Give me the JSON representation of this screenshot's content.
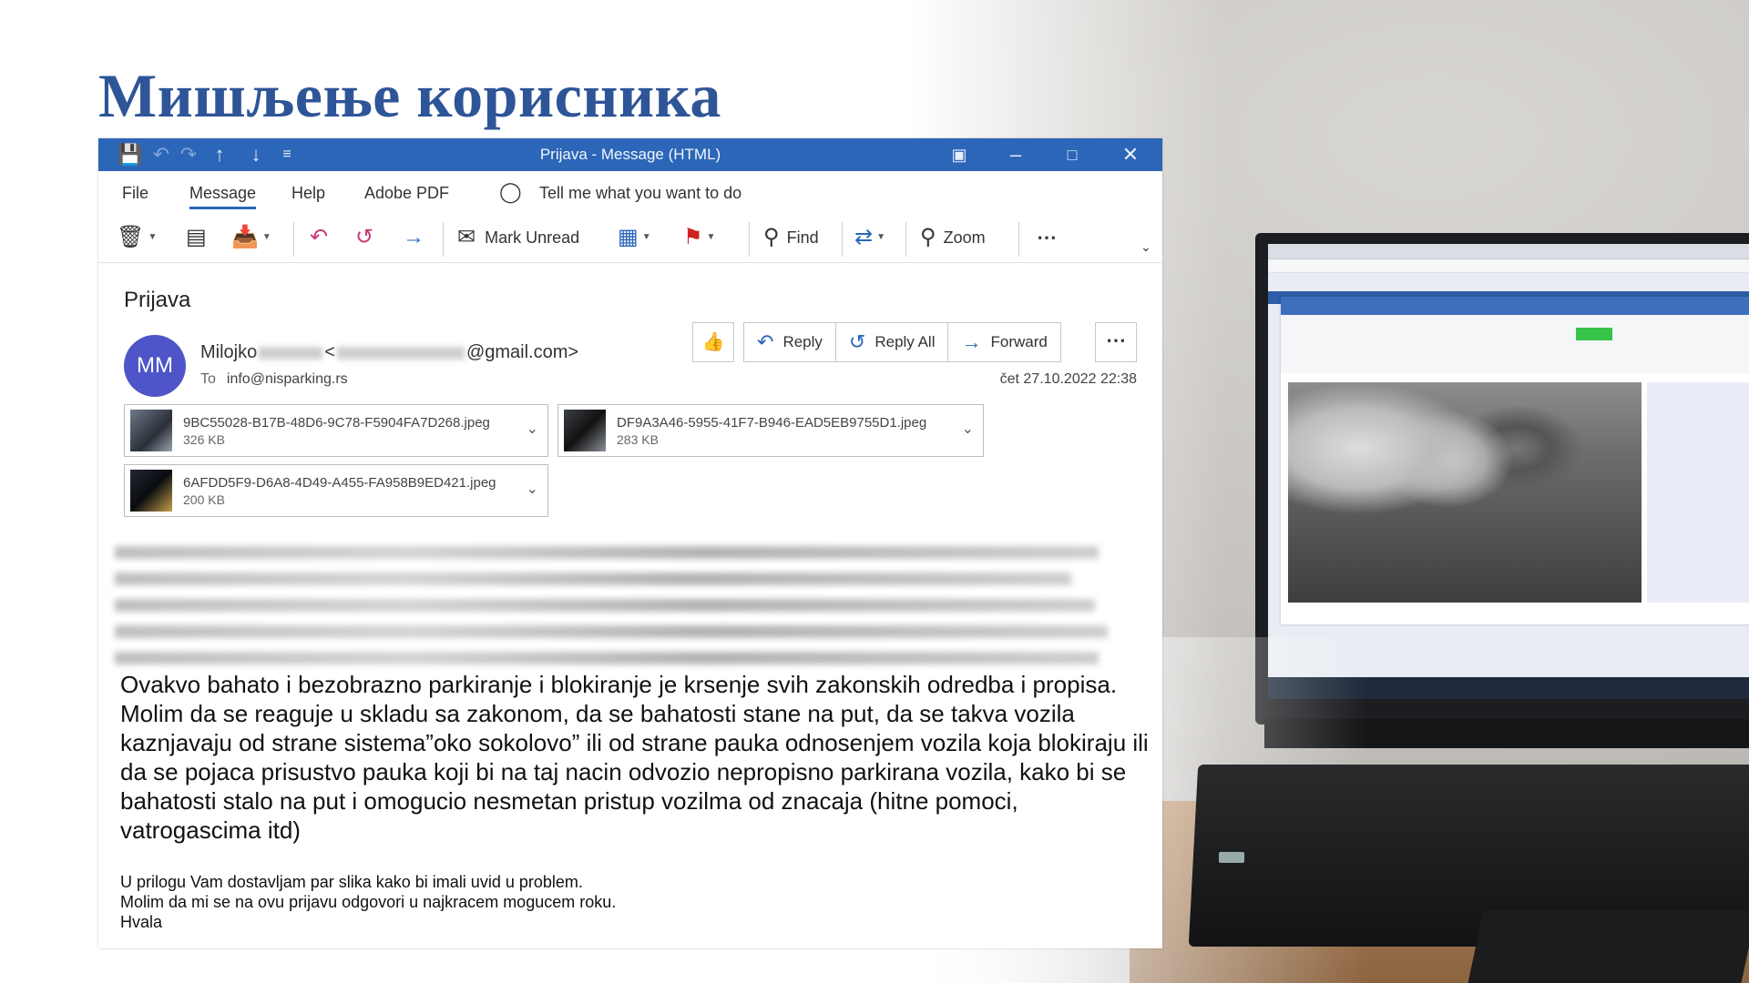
{
  "slide": {
    "title": "Мишљење корисника"
  },
  "window": {
    "title": "Prijava  -  Message (HTML)"
  },
  "menu": {
    "items": [
      "File",
      "Message",
      "Help",
      "Adobe PDF"
    ],
    "active": "Message",
    "tell_me": "Tell me what you want to do"
  },
  "ribbon": {
    "mark_unread": "Mark Unread",
    "find": "Find",
    "zoom": "Zoom"
  },
  "email": {
    "subject": "Prijava",
    "avatar_initials": "MM",
    "sender_first": "Milojko",
    "sender_email_domain": "@gmail.com>",
    "to_label": "To",
    "to_address": "info@nisparking.rs",
    "date": "čet 27.10.2022 22:38",
    "actions": {
      "reply": "Reply",
      "reply_all": "Reply All",
      "forward": "Forward"
    },
    "attachments": [
      {
        "name": "9BC55028-B17B-48D6-9C78-F5904FA7D268.jpeg",
        "size": "326 KB"
      },
      {
        "name": "DF9A3A46-5955-41F7-B946-EAD5EB9755D1.jpeg",
        "size": "283 KB"
      },
      {
        "name": "6AFDD5F9-D6A8-4D49-A455-FA958B9ED421.jpeg",
        "size": "200 KB"
      }
    ],
    "body_main": "Ovakvo bahato i bezobrazno parkiranje i blokiranje je krsenje svih zakonskih odredba i propisa. Molim da se reaguje u skladu sa zakonom, da se bahatosti stane na put, da se takva vozila kaznjavaju od strane sistema”oko sokolovo” ili od strane pauka odnosenjem vozila koja blokiraju ili da se pojaca prisustvo pauka koji bi na taj nacin odvozio nepropisno parkirana vozila, kako bi se bahatosti stalo na put i omogucio nesmetan pristup vozilma od znacaja (hitne pomoci, vatrogascima itd)",
    "footer_lines": [
      "U prilogu Vam dostavljam par slika kako bi imali uvid u problem.",
      "Molim da mi se na ovu prijavu odgovori u najkracem mogucem roku.",
      "Hvala"
    ]
  },
  "colors": {
    "title_blue": "#2e5597",
    "titlebar": "#2b66b8",
    "avatar": "#4d55c8"
  }
}
